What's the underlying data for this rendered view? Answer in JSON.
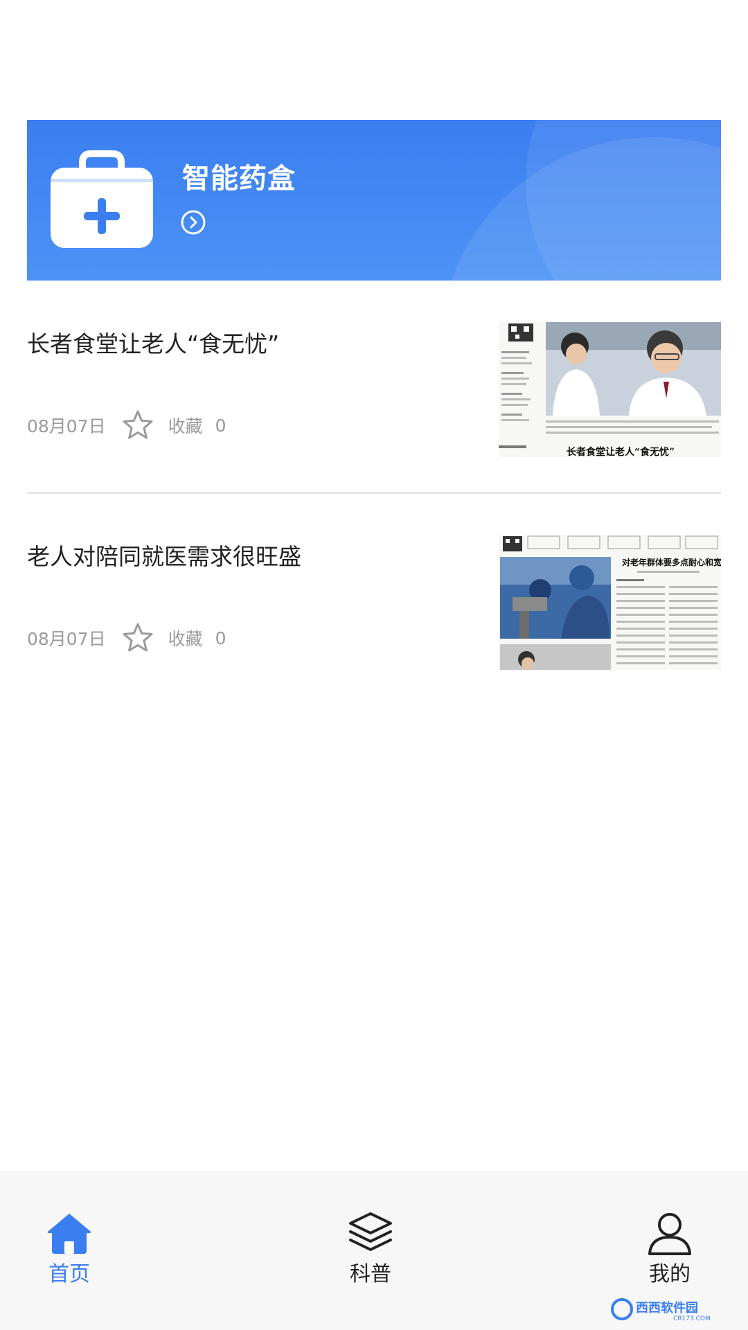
{
  "banner": {
    "title": "智能药盒",
    "icon": "medicine-kit-icon",
    "arrow_icon": "chevron-right-circle-icon"
  },
  "articles": [
    {
      "title": "长者食堂让老人“食无忧”",
      "date": "08月07日",
      "favorite_label": "收藏",
      "favorite_count": "0",
      "thumbnail_headline": "长者食堂让老人“食无忧”"
    },
    {
      "title": "老人对陪同就医需求很旺盛",
      "date": "08月07日",
      "favorite_label": "收藏",
      "favorite_count": "0",
      "thumbnail_headline": "对老年群体要多点耐心和宽容"
    }
  ],
  "tabbar": {
    "tabs": [
      {
        "label": "首页",
        "icon": "home-icon",
        "active": true
      },
      {
        "label": "科普",
        "icon": "layers-icon",
        "active": false
      },
      {
        "label": "我的",
        "icon": "user-icon",
        "active": false
      }
    ]
  },
  "watermark": {
    "text": "西西软件园",
    "sub": "CR173.COM"
  },
  "colors": {
    "accent": "#3a7ef0",
    "text": "#222222",
    "muted": "#9a9a9a"
  }
}
